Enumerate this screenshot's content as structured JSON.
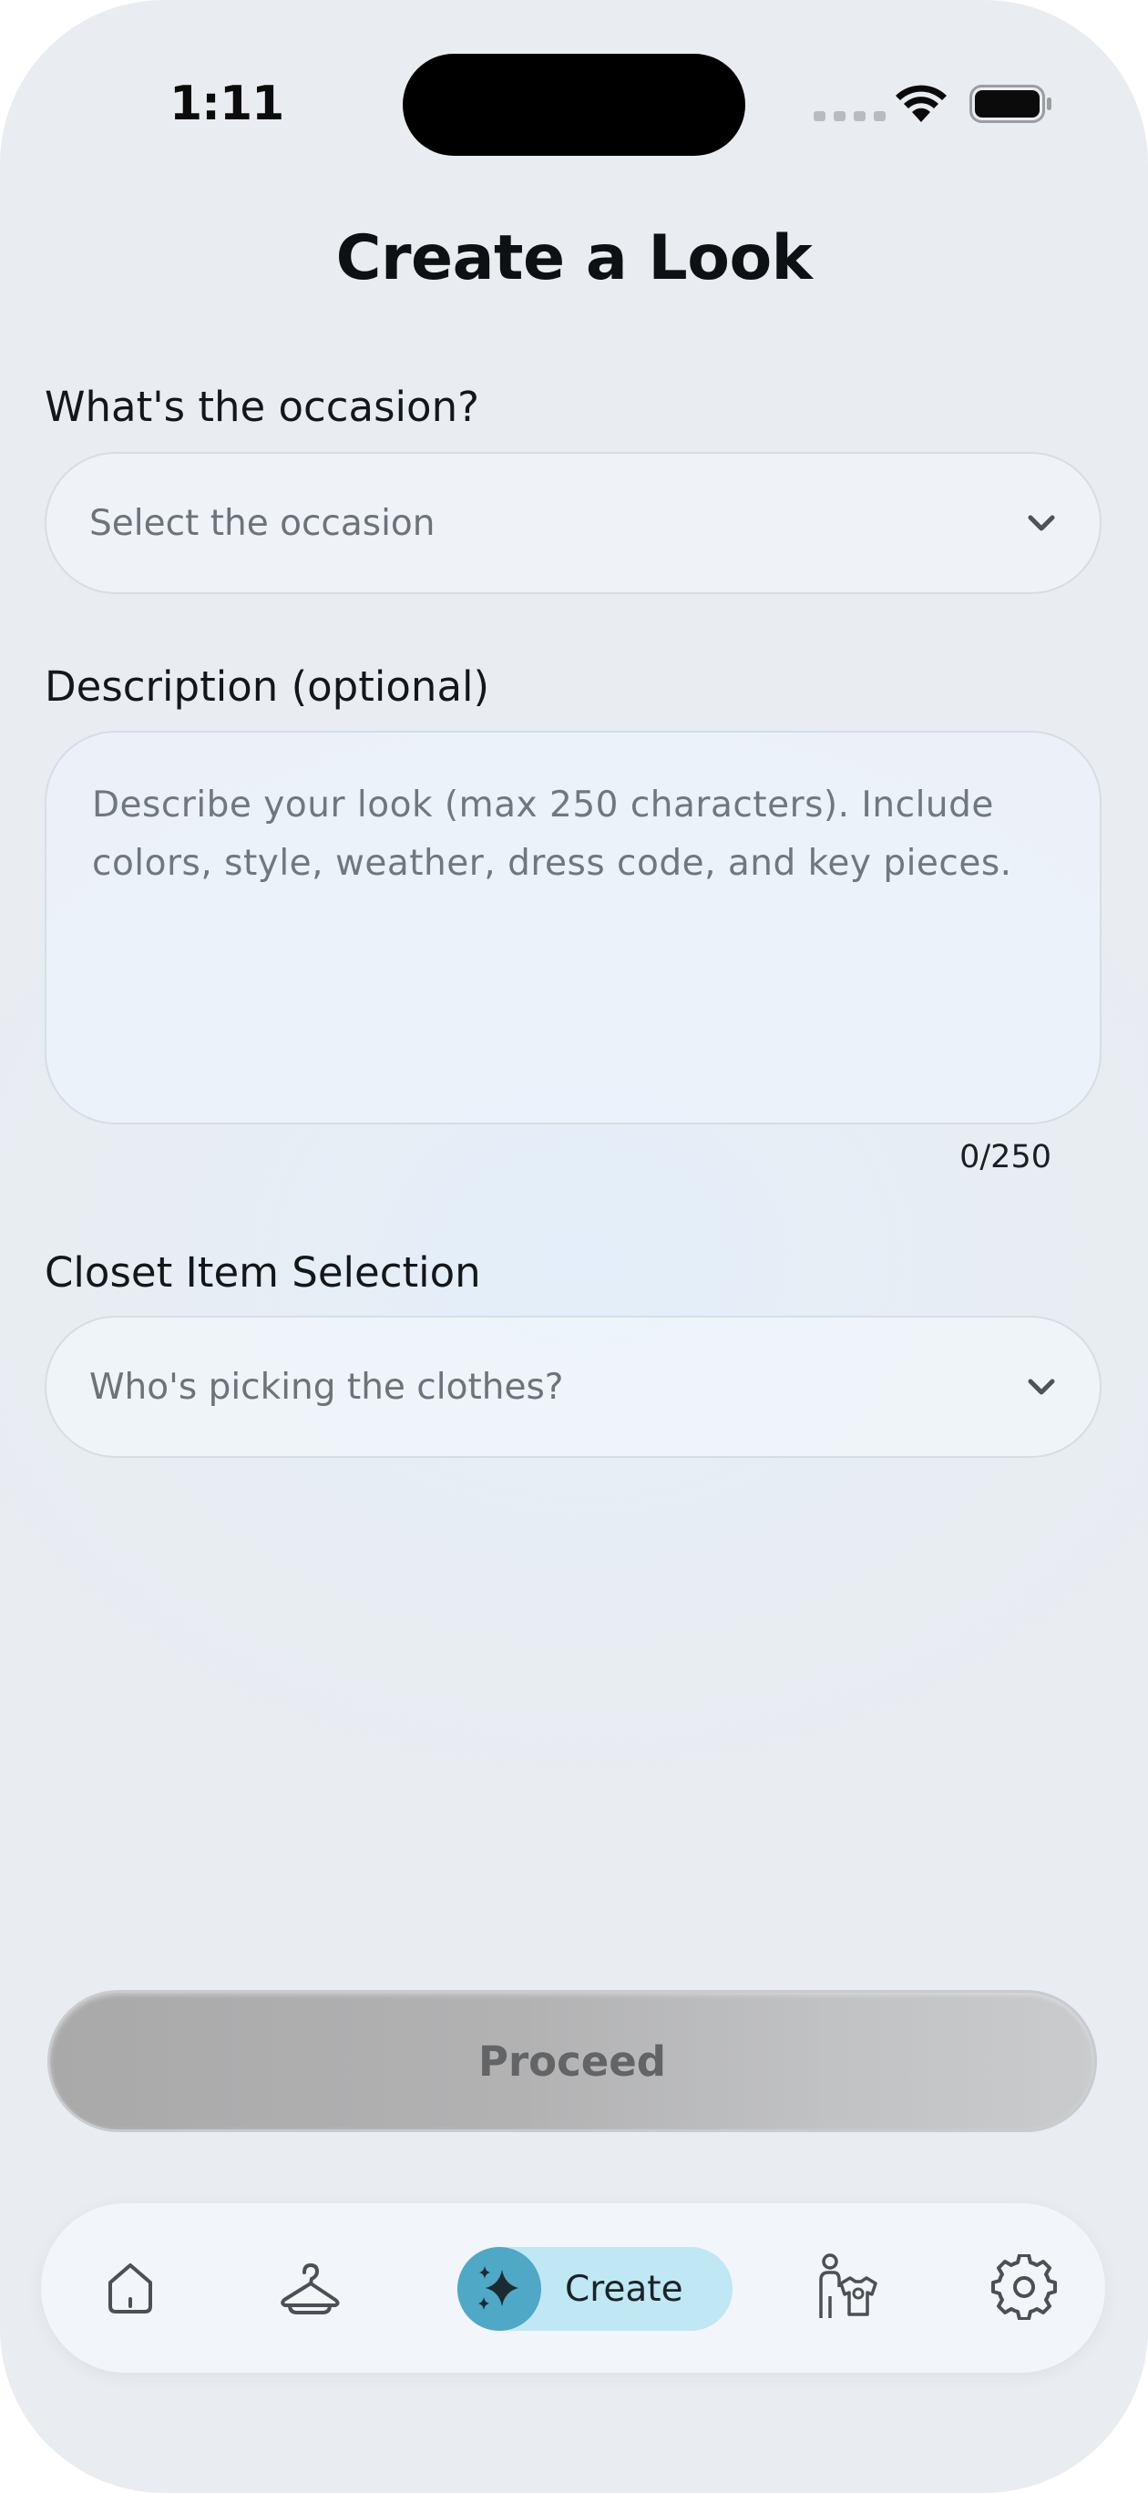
{
  "status_bar": {
    "time": "1:11"
  },
  "page": {
    "title": "Create a Look"
  },
  "occasion": {
    "label": "What's the occasion?",
    "placeholder": "Select the occasion"
  },
  "description": {
    "label": "Description (optional)",
    "placeholder": "Describe your look (max 250 characters). Include colors, style, weather, dress code, and key pieces.",
    "counter": "0/250"
  },
  "closet": {
    "label": "Closet Item Selection",
    "placeholder": "Who's picking the clothes?"
  },
  "proceed_label": "Proceed",
  "tabbar": {
    "items": [
      {
        "icon": "home-icon"
      },
      {
        "icon": "hanger-icon"
      },
      {
        "icon": "sparkles-icon",
        "label": "Create",
        "active": true
      },
      {
        "icon": "person-outfit-icon"
      },
      {
        "icon": "gear-icon"
      }
    ]
  },
  "colors": {
    "accent": "#4ea8c6",
    "accent_soft": "#bfe7f4",
    "button_disabled": "#b2b2b3"
  }
}
